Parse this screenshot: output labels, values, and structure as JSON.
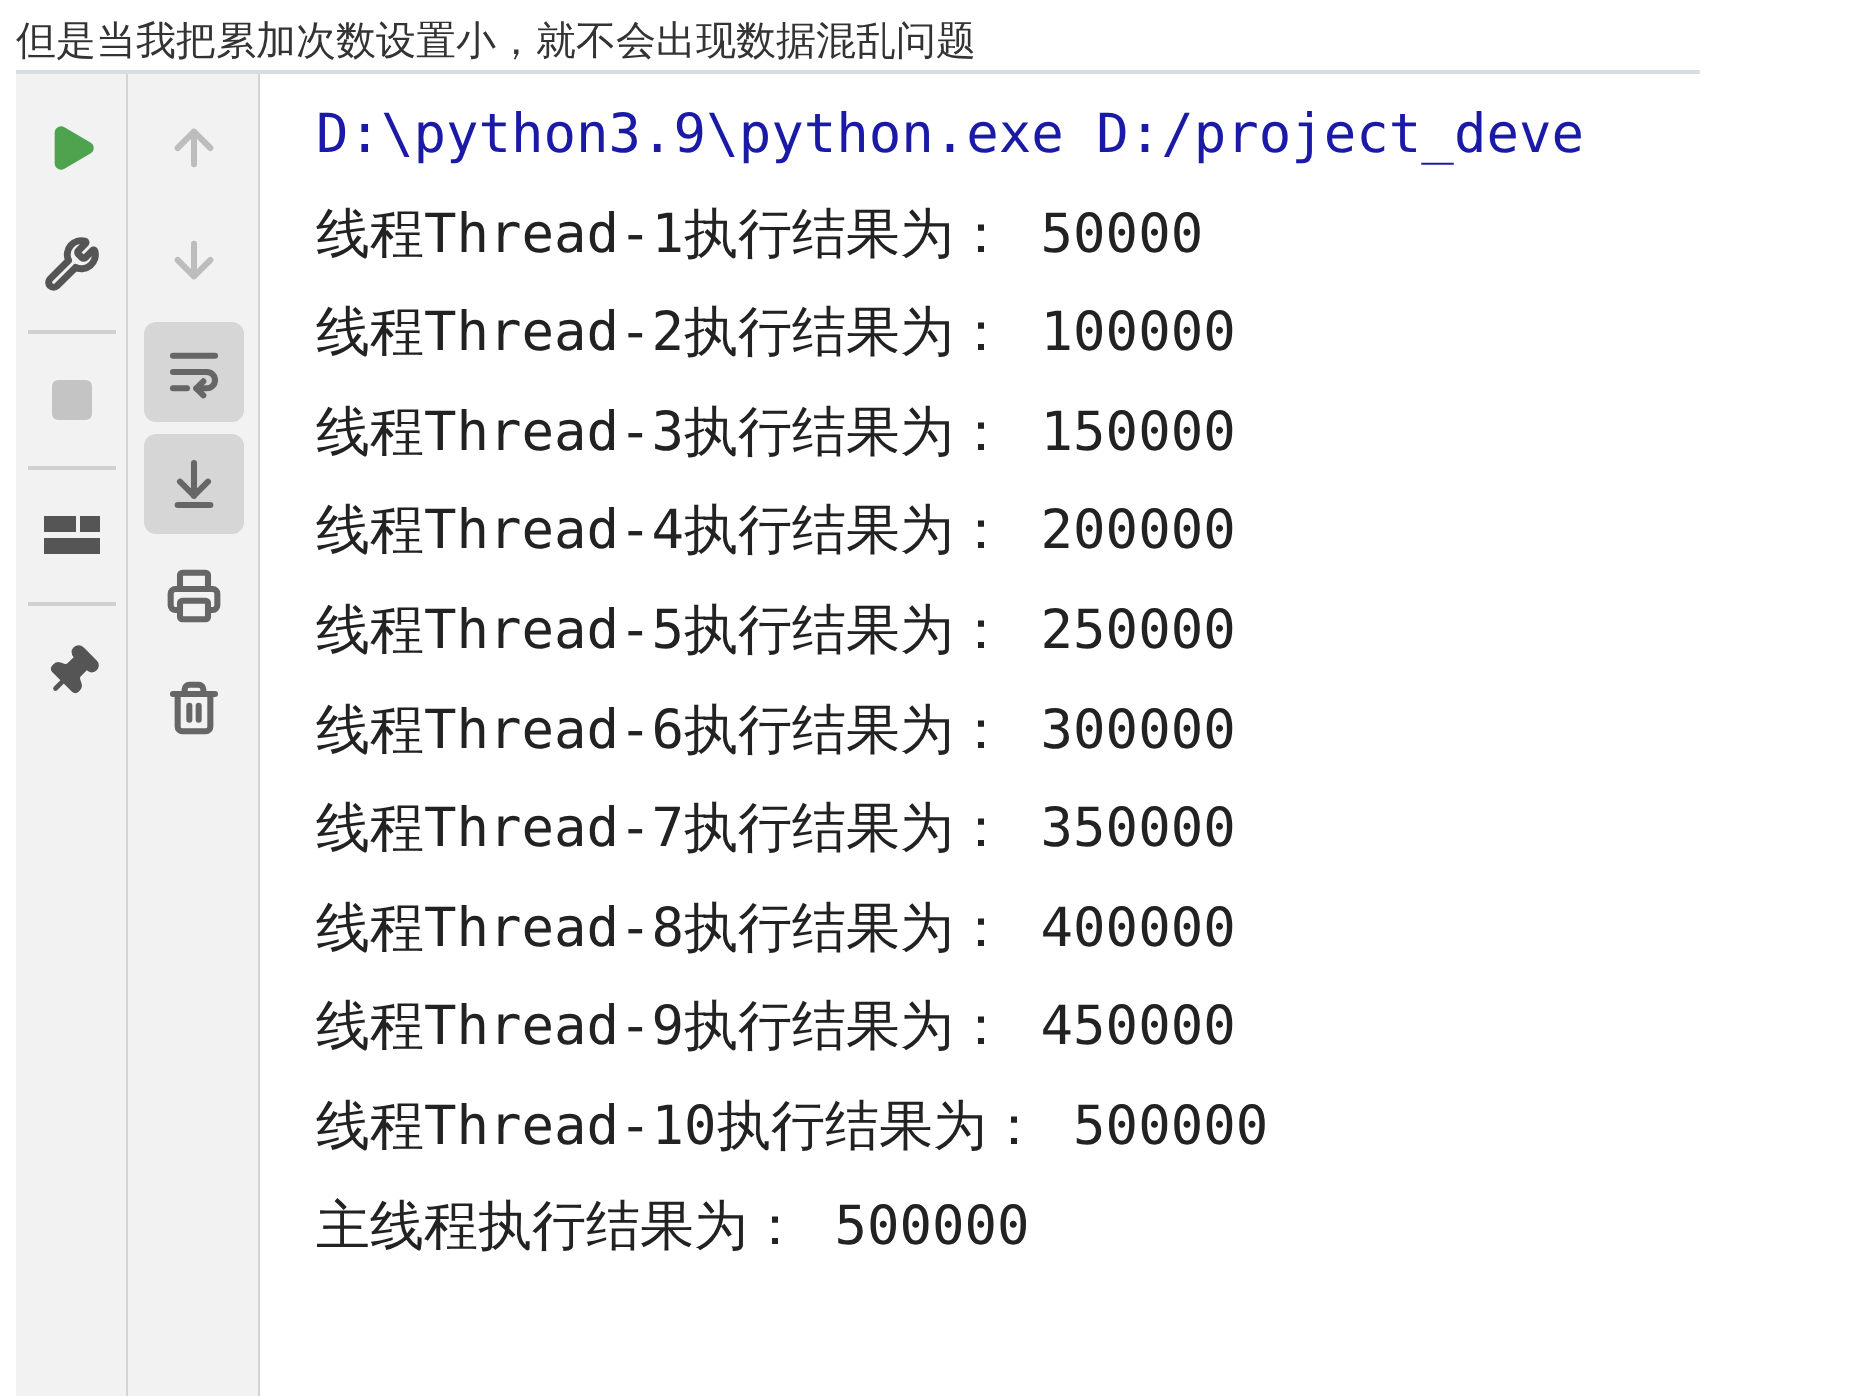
{
  "caption": "但是当我把累加次数设置小，就不会出现数据混乱问题",
  "side_toolbar": [
    {
      "selected": false
    },
    {
      "selected": false
    },
    {
      "selected": true
    },
    {
      "selected": true
    },
    {
      "selected": false
    },
    {
      "selected": false
    }
  ],
  "console": {
    "command": "D:\\python3.9\\python.exe D:/project_deve",
    "lines": [
      "线程Thread-1执行结果为： 50000",
      "线程Thread-2执行结果为： 100000",
      "线程Thread-3执行结果为： 150000",
      "线程Thread-4执行结果为： 200000",
      "线程Thread-5执行结果为： 250000",
      "线程Thread-6执行结果为： 300000",
      "线程Thread-7执行结果为： 350000",
      "线程Thread-8执行结果为： 400000",
      "线程Thread-9执行结果为： 450000",
      "线程Thread-10执行结果为： 500000",
      "主线程执行结果为： 500000"
    ]
  }
}
